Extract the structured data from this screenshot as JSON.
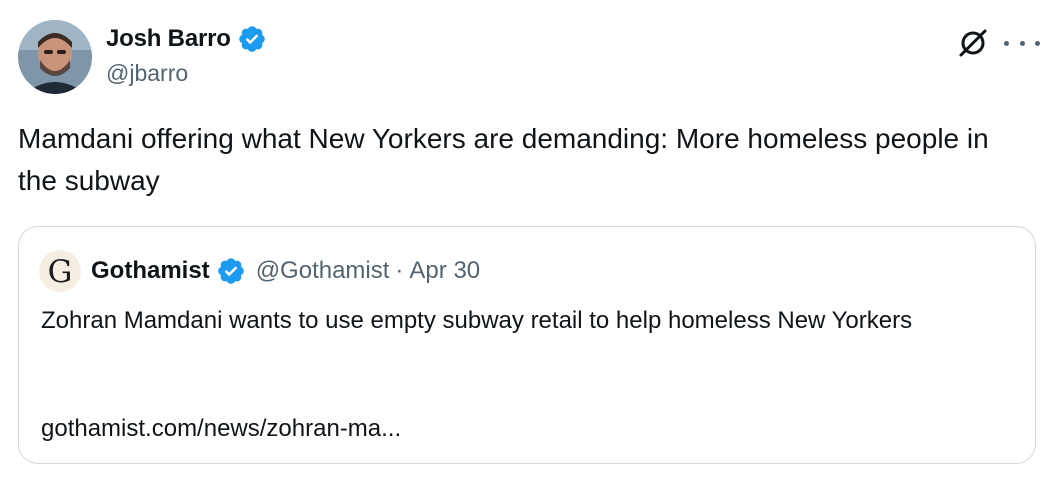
{
  "author": {
    "name": "Josh Barro",
    "handle": "@jbarro",
    "verified": true,
    "avatar_icon": "profile-photo"
  },
  "icons": {
    "grok": "grok-icon",
    "more": "more-options-icon",
    "verified_color": "#1d9bf0"
  },
  "tweet": {
    "text": "Mamdani offering what New Yorkers are demanding: More homeless people in the subway"
  },
  "quote": {
    "logo_letter": "G",
    "name": "Gothamist",
    "handle": "@Gothamist",
    "separator": "·",
    "date": "Apr 30",
    "text": "Zohran Mamdani wants to use empty subway retail to help homeless New Yorkers",
    "link": "gothamist.com/news/zohran-ma..."
  }
}
